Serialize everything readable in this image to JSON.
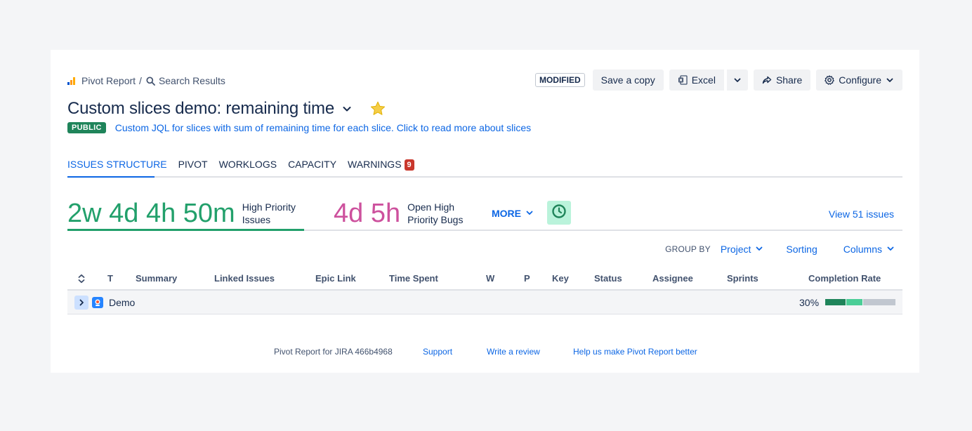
{
  "breadcrumb": {
    "root": "Pivot Report",
    "separator": "/",
    "current": "Search Results"
  },
  "actions": {
    "modified_badge": "MODIFIED",
    "save_copy": "Save a copy",
    "excel": "Excel",
    "share": "Share",
    "configure": "Configure"
  },
  "report": {
    "title": "Custom slices demo: remaining time",
    "visibility_badge": "PUBLIC",
    "description": "Custom JQL for slices with sum of remaining time for each slice. Click to read more about slices"
  },
  "tabs": [
    {
      "label": "ISSUES STRUCTURE",
      "active": true
    },
    {
      "label": "PIVOT"
    },
    {
      "label": "WORKLOGS"
    },
    {
      "label": "CAPACITY"
    },
    {
      "label": "WARNINGS",
      "count": "9"
    }
  ],
  "slices": [
    {
      "value": "2w 4d 4h 50m",
      "label_line1": "High Priority",
      "label_line2": "Issues",
      "color": "#22a06b",
      "active": true
    },
    {
      "value": "4d 5h",
      "label_line1": "Open High",
      "label_line2": "Priority Bugs",
      "color": "#cd519d"
    }
  ],
  "slice_bar": {
    "more": "MORE",
    "view_issues": "View 51 issues"
  },
  "group_bar": {
    "group_by_label": "GROUP BY",
    "group_value": "Project",
    "sorting": "Sorting",
    "columns": "Columns"
  },
  "table": {
    "headers": [
      "T",
      "Summary",
      "Linked Issues",
      "Epic Link",
      "Time Spent",
      "W",
      "P",
      "Key",
      "Status",
      "Assignee",
      "Sprints",
      "Completion Rate"
    ],
    "rows": [
      {
        "name": "Demo",
        "completion": "30%",
        "segments": [
          {
            "fraction": 0.3,
            "color": "#1f845a"
          },
          {
            "fraction": 0.23,
            "color": "#4bce97"
          },
          {
            "fraction": 0.47,
            "color": "#c1c7d0"
          }
        ]
      }
    ]
  },
  "footer": {
    "version": "Pivot Report for JIRA 466b4968",
    "support": "Support",
    "review": "Write a review",
    "feedback": "Help us make Pivot Report better"
  },
  "colors": {
    "link": "#0c66e4",
    "accent_green": "#22a06b",
    "accent_pink": "#cd519d",
    "warning_red": "#c9372c"
  }
}
